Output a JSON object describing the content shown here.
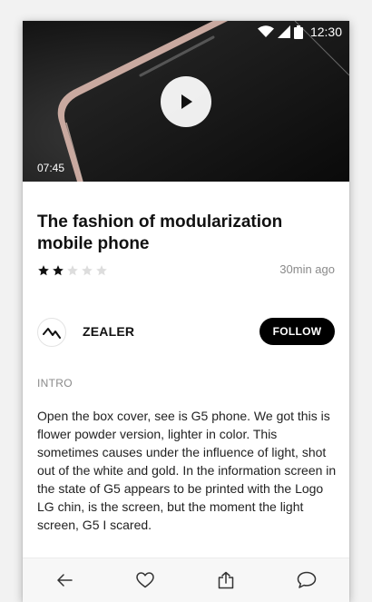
{
  "status_bar": {
    "time": "12:30",
    "icons": [
      "wifi-icon",
      "signal-icon",
      "battery-icon"
    ]
  },
  "video": {
    "duration": "07:45",
    "play_icon": "play-icon"
  },
  "article": {
    "title": "The fashion of modularization mobile phone",
    "rating": 2,
    "rating_max": 5,
    "time_ago": "30min ago"
  },
  "author": {
    "name": "ZEALER",
    "avatar_icon": "zealer-logo-icon",
    "follow_label": "FOLLOW"
  },
  "intro": {
    "label": "INTRO",
    "text": "Open the box cover, see is G5 phone. We got this is flower powder version, lighter in color. This sometimes causes under the influence of light, shot out of the white and gold. In the information screen in the state of G5 appears to be printed with the Logo LG chin, is the screen, but the moment the light screen, G5 I scared."
  },
  "bottom_bar": {
    "icons": [
      "back-arrow-icon",
      "heart-icon",
      "share-icon",
      "comment-icon"
    ]
  },
  "colors": {
    "accent": "#000000",
    "star_filled": "#111111",
    "star_empty": "#dddddd",
    "muted_text": "#8a8a8a"
  }
}
